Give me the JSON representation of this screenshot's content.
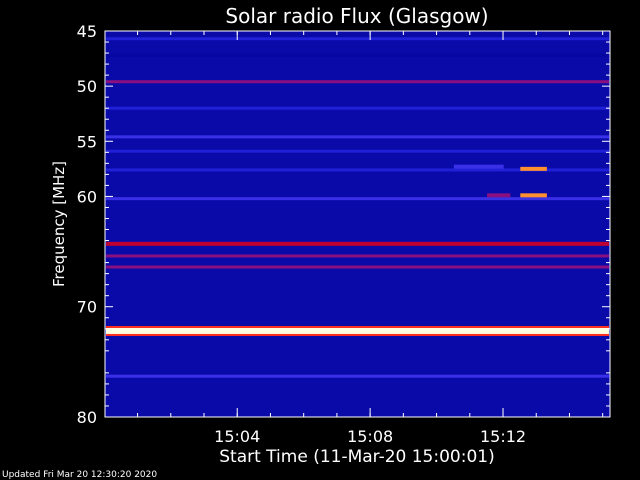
{
  "footer": {
    "updated": "Updated Fri Mar 20 12:30:20 2020"
  },
  "colors": {
    "background": "#000000",
    "axis": "#ffffff",
    "low": "#0a0aa8",
    "mid": "#c00040",
    "high": "#ffff40"
  },
  "chart_data": {
    "type": "heatmap",
    "title": "Solar radio Flux (Glasgow)",
    "xlabel": "Start Time (11-Mar-20 15:00:01)",
    "ylabel": "Frequency [MHz]",
    "x_unit": "minutes after 15:00:01",
    "xlim": [
      0,
      15.2
    ],
    "ylim": [
      45,
      80
    ],
    "y_inverted": true,
    "x_ticks": [
      {
        "value": 3.98,
        "label": "15:04"
      },
      {
        "value": 7.98,
        "label": "15:08"
      },
      {
        "value": 11.98,
        "label": "15:12"
      }
    ],
    "y_ticks": [
      {
        "value": 45,
        "label": "45"
      },
      {
        "value": 50,
        "label": "50"
      },
      {
        "value": 55,
        "label": "55"
      },
      {
        "value": 60,
        "label": "60"
      },
      {
        "value": 70,
        "label": "70"
      },
      {
        "value": 80,
        "label": "80"
      }
    ],
    "colormap": "blue-red-yellow",
    "bands": [
      {
        "freq": 45.7,
        "intensity": 0.15
      },
      {
        "freq": 47.2,
        "intensity": 0.08
      },
      {
        "freq": 49.6,
        "intensity": 0.45
      },
      {
        "freq": 52.0,
        "intensity": 0.12
      },
      {
        "freq": 54.6,
        "intensity": 0.35
      },
      {
        "freq": 55.9,
        "intensity": 0.15
      },
      {
        "freq": 57.6,
        "intensity": 0.18
      },
      {
        "freq": 60.2,
        "intensity": 0.3
      },
      {
        "freq": 64.3,
        "intensity": 0.75
      },
      {
        "freq": 65.4,
        "intensity": 0.55
      },
      {
        "freq": 66.4,
        "intensity": 0.45
      },
      {
        "freq": 72.2,
        "intensity": 1.0
      },
      {
        "freq": 76.3,
        "intensity": 0.35
      }
    ],
    "bursts": [
      {
        "t_start": 10.5,
        "t_end": 12.0,
        "freq": 57.3,
        "intensity": 0.35
      },
      {
        "t_start": 12.5,
        "t_end": 13.3,
        "freq": 57.5,
        "intensity": 0.85
      },
      {
        "t_start": 11.5,
        "t_end": 12.2,
        "freq": 59.9,
        "intensity": 0.5
      },
      {
        "t_start": 12.5,
        "t_end": 13.3,
        "freq": 59.9,
        "intensity": 0.9
      }
    ]
  }
}
